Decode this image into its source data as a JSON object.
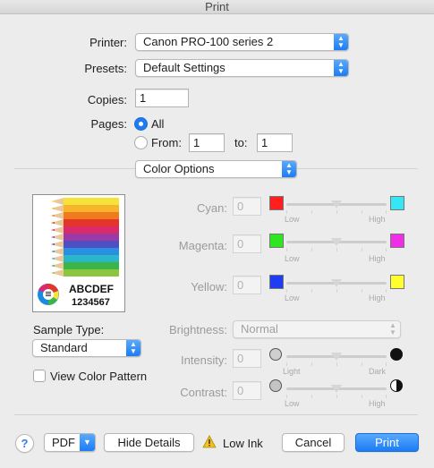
{
  "window": {
    "title": "Print"
  },
  "printer": {
    "label": "Printer:",
    "value": "Canon PRO-100 series 2"
  },
  "presets": {
    "label": "Presets:",
    "value": "Default Settings"
  },
  "copies": {
    "label": "Copies:",
    "value": "1"
  },
  "pages": {
    "label": "Pages:",
    "all_label": "All",
    "from_label": "From:",
    "from_value": "1",
    "to_label": "to:",
    "to_value": "1",
    "selected": "All"
  },
  "section_popup": {
    "value": "Color Options"
  },
  "preview": {
    "line1": "ABCDEF",
    "line2": "1234567"
  },
  "sample_type": {
    "label": "Sample Type:",
    "value": "Standard"
  },
  "view_pattern": {
    "label": "View Color Pattern",
    "checked": false
  },
  "colors": {
    "cyan": {
      "label": "Cyan:",
      "value": "0",
      "low": "Low",
      "high": "High",
      "low_color": "#ff1f1f",
      "high_color": "#35e6f5"
    },
    "magenta": {
      "label": "Magenta:",
      "value": "0",
      "low": "Low",
      "high": "High",
      "low_color": "#2ee61f",
      "high_color": "#f02ee8"
    },
    "yellow": {
      "label": "Yellow:",
      "value": "0",
      "low": "Low",
      "high": "High",
      "low_color": "#1f3cf0",
      "high_color": "#ffff2e"
    }
  },
  "brightness": {
    "label": "Brightness:",
    "value": "Normal"
  },
  "intensity": {
    "label": "Intensity:",
    "value": "0",
    "low": "Light",
    "high": "Dark"
  },
  "contrast": {
    "label": "Contrast:",
    "value": "0",
    "low": "Low",
    "high": "High"
  },
  "footer": {
    "help": "?",
    "pdf": "PDF",
    "hide_details": "Hide Details",
    "warning": "Low Ink",
    "cancel": "Cancel",
    "print": "Print"
  }
}
